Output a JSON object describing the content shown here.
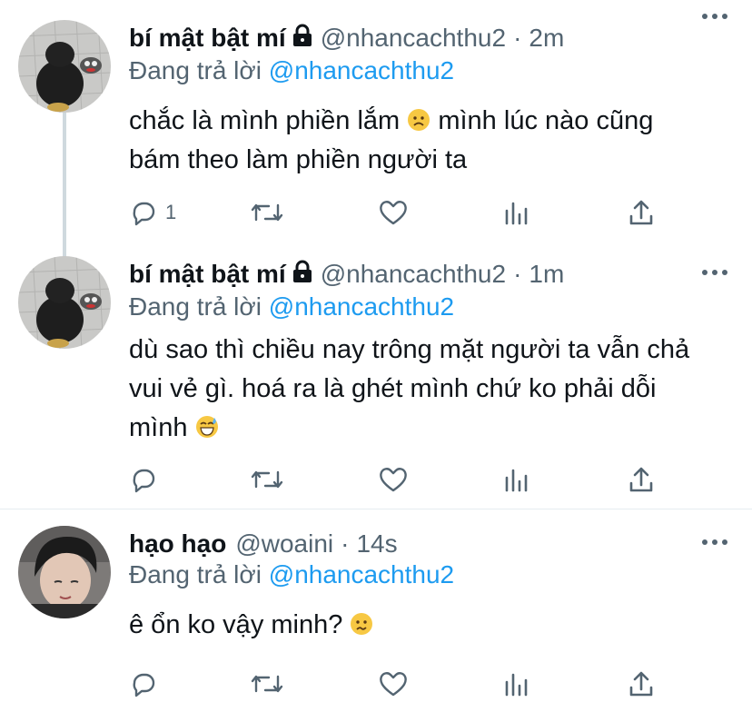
{
  "tweets": [
    {
      "name": "bí mật bật mí",
      "handle": "@nhancachthu2",
      "separator": "·",
      "time": "2m",
      "reply_prefix": "Đang trả lời",
      "reply_mention": "@nhancachthu2",
      "text_a": "chắc là mình phiền lắm",
      "text_b": "mình lúc nào cũng",
      "text_c": "bám theo làm phiền người ta",
      "reply_count": "1",
      "emoji": "frowning-face",
      "locked": true
    },
    {
      "name": "bí mật bật mí",
      "handle": "@nhancachthu2",
      "separator": "·",
      "time": "1m",
      "reply_prefix": "Đang trả lời",
      "reply_mention": "@nhancachthu2",
      "text_a": "dù sao thì chiều nay trông mặt người ta vẫn chả",
      "text_b": "vui vẻ gì. hoá ra là ghét mình chứ ko phải dỗi",
      "text_c": "mình",
      "reply_count": "",
      "emoji": "grinning-sweat-face",
      "locked": true
    },
    {
      "name": "hạo hạo",
      "handle": "@woaini",
      "separator": "·",
      "time": "14s",
      "reply_prefix": "Đang trả lời",
      "reply_mention": "@nhancachthu2",
      "text_a": "ê ổn ko vậy minh?",
      "reply_count": "",
      "emoji": "confused-face",
      "locked": false
    }
  ],
  "colors": {
    "accent": "#1d9bf0",
    "muted": "#536471",
    "text": "#0f1419",
    "divider": "#e6ecf0",
    "thread_line": "#cfd9de"
  },
  "icons": [
    "reply-icon",
    "retweet-icon",
    "like-icon",
    "analytics-icon",
    "share-icon",
    "more-icon",
    "lock-icon"
  ]
}
